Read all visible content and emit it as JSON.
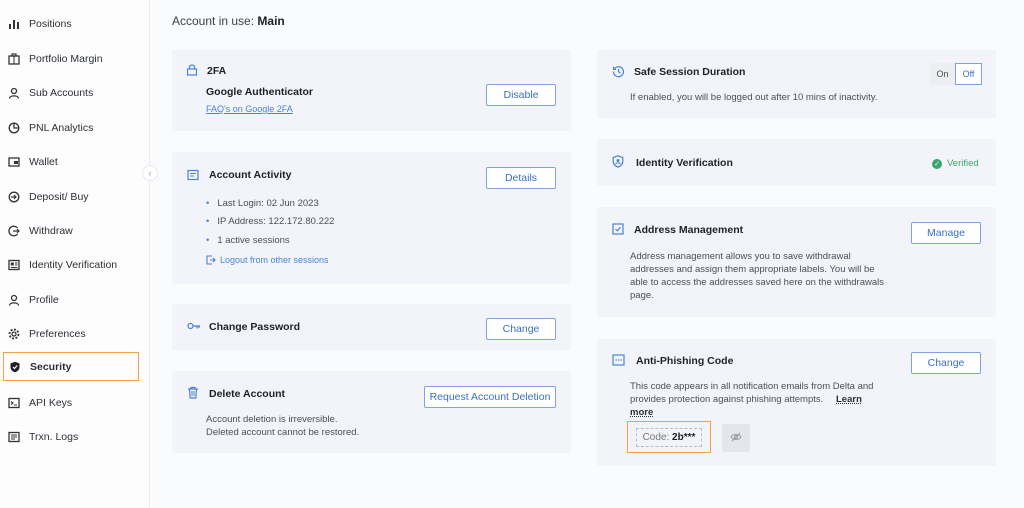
{
  "sidebar": {
    "items": [
      {
        "label": "Positions",
        "icon": "bar-chart-icon"
      },
      {
        "label": "Portfolio Margin",
        "icon": "briefcase-icon"
      },
      {
        "label": "Sub Accounts",
        "icon": "user-icon"
      },
      {
        "label": "PNL Analytics",
        "icon": "pie-chart-icon"
      },
      {
        "label": "Wallet",
        "icon": "wallet-icon"
      },
      {
        "label": "Deposit/ Buy",
        "icon": "deposit-icon"
      },
      {
        "label": "Withdraw",
        "icon": "withdraw-icon"
      },
      {
        "label": "Identity Verification",
        "icon": "id-card-icon"
      },
      {
        "label": "Profile",
        "icon": "profile-icon"
      },
      {
        "label": "Preferences",
        "icon": "gear-icon"
      },
      {
        "label": "Security",
        "icon": "shield-icon"
      },
      {
        "label": "API Keys",
        "icon": "api-key-icon"
      },
      {
        "label": "Trxn. Logs",
        "icon": "logs-icon"
      }
    ],
    "active": "Security"
  },
  "account": {
    "prefix": "Account in use:",
    "name": "Main"
  },
  "twofa": {
    "title": "2FA",
    "method": "Google Authenticator",
    "faq_link": "FAQ's on Google 2FA",
    "button": "Disable"
  },
  "activity": {
    "title": "Account Activity",
    "button": "Details",
    "items": [
      "Last Login: 02 Jun 2023",
      "IP Address: 122.172.80.222",
      "1 active sessions"
    ],
    "logout_link": "Logout from other sessions"
  },
  "password": {
    "title": "Change Password",
    "button": "Change"
  },
  "delete": {
    "title": "Delete Account",
    "button": "Request Account Deletion",
    "line1": "Account deletion is irreversible.",
    "line2": "Deleted account cannot be restored."
  },
  "session": {
    "title": "Safe Session Duration",
    "desc": "If enabled, you will be logged out after 10 mins of inactivity.",
    "on": "On",
    "off": "Off",
    "selected": "Off"
  },
  "identity": {
    "title": "Identity Verification",
    "status": "Verified",
    "status_color": "#3aa66a"
  },
  "address": {
    "title": "Address Management",
    "button": "Manage",
    "desc1": "Address management allows you to save withdrawal",
    "desc2": "addresses and assign them appropriate labels. You will be",
    "desc3": "able to access the addresses saved here on the withdrawals",
    "desc4": "page."
  },
  "phishing": {
    "title": "Anti-Phishing Code",
    "button": "Change",
    "desc1": "This code appears in all notification emails from Delta and",
    "desc2": "provides protection against phishing attempts.",
    "learn1": "Learn",
    "learn2": "more",
    "code_label": "Code:",
    "code_value": "2b***"
  },
  "colors": {
    "accent": "#3a6fc9",
    "highlight": "#f2a041",
    "card": "#f3f4f9"
  }
}
